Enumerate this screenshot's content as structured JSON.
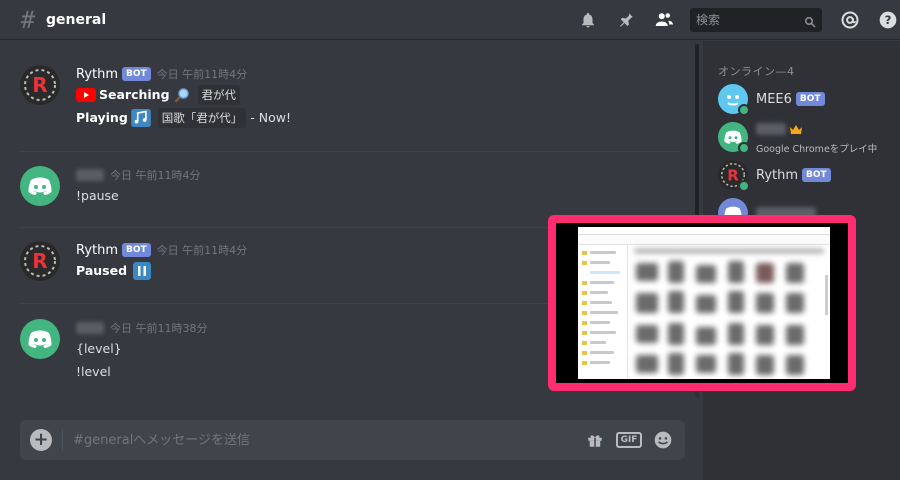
{
  "header": {
    "channel_name": "general",
    "search_placeholder": "検索",
    "colors": {
      "background": "#36393f",
      "sidebar": "#2f3136",
      "accent": "#7289da",
      "online": "#43b581",
      "highlight_border": "#ff2d6f"
    }
  },
  "messages": [
    {
      "author": "Rythm",
      "bot_tag": "BOT",
      "timestamp": "今日 午前11時4分",
      "lines": [
        {
          "label": "Searching",
          "code": "君が代"
        },
        {
          "label": "Playing",
          "code": "国歌「君が代」",
          "suffix": "- Now!"
        }
      ]
    },
    {
      "author": "",
      "timestamp": "今日 午前11時4分",
      "lines": [
        {
          "text": "!pause"
        }
      ]
    },
    {
      "author": "Rythm",
      "bot_tag": "BOT",
      "timestamp": "今日 午前11時4分",
      "lines": [
        {
          "label": "Paused"
        }
      ]
    },
    {
      "author": "",
      "timestamp": "今日 午前11時38分",
      "lines": [
        {
          "text": "{level}"
        },
        {
          "text": "!level"
        }
      ]
    }
  ],
  "composer": {
    "placeholder": "#generalへメッセージを送信",
    "gif_label": "GIF"
  },
  "members": {
    "header": "オンライン—4",
    "list": [
      {
        "name": "MEE6",
        "bot_tag": "BOT",
        "avatar_icon": "mee6-avatar-icon"
      },
      {
        "name": "",
        "activity": "Google Chromeをプレイ中",
        "avatar_icon": "discord-avatar-icon"
      },
      {
        "name": "Rythm",
        "bot_tag": "BOT",
        "avatar_icon": "rythm-avatar-icon"
      },
      {
        "name": "",
        "avatar_icon": "discord-avatar-icon"
      }
    ]
  }
}
